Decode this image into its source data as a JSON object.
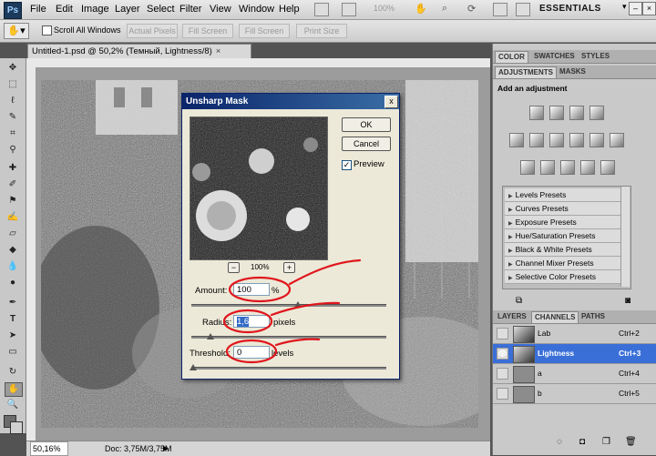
{
  "app": {
    "menu": [
      "File",
      "Edit",
      "Image",
      "Layer",
      "Select",
      "Filter",
      "View",
      "Window",
      "Help"
    ],
    "zoom_display": "100%",
    "workspace": "ESSENTIALS"
  },
  "options_bar": {
    "scroll_all": "Scroll All Windows",
    "buttons": [
      "Actual Pixels",
      "Fill Screen",
      "Fill Screen",
      "Print Size"
    ]
  },
  "document": {
    "tab_title": "Untitled-1.psd @ 50,2% (Темный, Lightness/8)",
    "close": "×"
  },
  "status": {
    "zoom": "50,16%",
    "doc": "Doc: 3,75M/3,75M"
  },
  "dialog": {
    "title": "Unsharp Mask",
    "close": "x",
    "ok": "OK",
    "cancel": "Cancel",
    "preview_label": "Preview",
    "preview_checked": true,
    "zoom_minus": "−",
    "zoom_plus": "+",
    "zoom_level": "100%",
    "amount_label": "Amount:",
    "amount_value": "100",
    "amount_unit": "%",
    "radius_label": "Radius:",
    "radius_value": "1,6",
    "radius_unit": "pixels",
    "threshold_label": "Threshold:",
    "threshold_value": "0",
    "threshold_unit": "levels",
    "annotation_color": "#e0161d"
  },
  "panels": {
    "top_tabs": [
      "COLOR",
      "SWATCHES",
      "STYLES"
    ],
    "adj_tabs": [
      "ADJUSTMENTS",
      "MASKS"
    ],
    "add_adjustment": "Add an adjustment",
    "presets": [
      "Levels Presets",
      "Curves Presets",
      "Exposure Presets",
      "Hue/Saturation Presets",
      "Black & White Presets",
      "Channel Mixer Presets",
      "Selective Color Presets"
    ],
    "layer_tabs": [
      "LAYERS",
      "CHANNELS",
      "PATHS"
    ],
    "channels": [
      {
        "name": "Lab",
        "shortcut": "Ctrl+2",
        "selected": false,
        "visible": false
      },
      {
        "name": "Lightness",
        "shortcut": "Ctrl+3",
        "selected": true,
        "visible": true
      },
      {
        "name": "a",
        "shortcut": "Ctrl+4",
        "selected": false,
        "visible": false
      },
      {
        "name": "b",
        "shortcut": "Ctrl+5",
        "selected": false,
        "visible": false
      }
    ]
  }
}
